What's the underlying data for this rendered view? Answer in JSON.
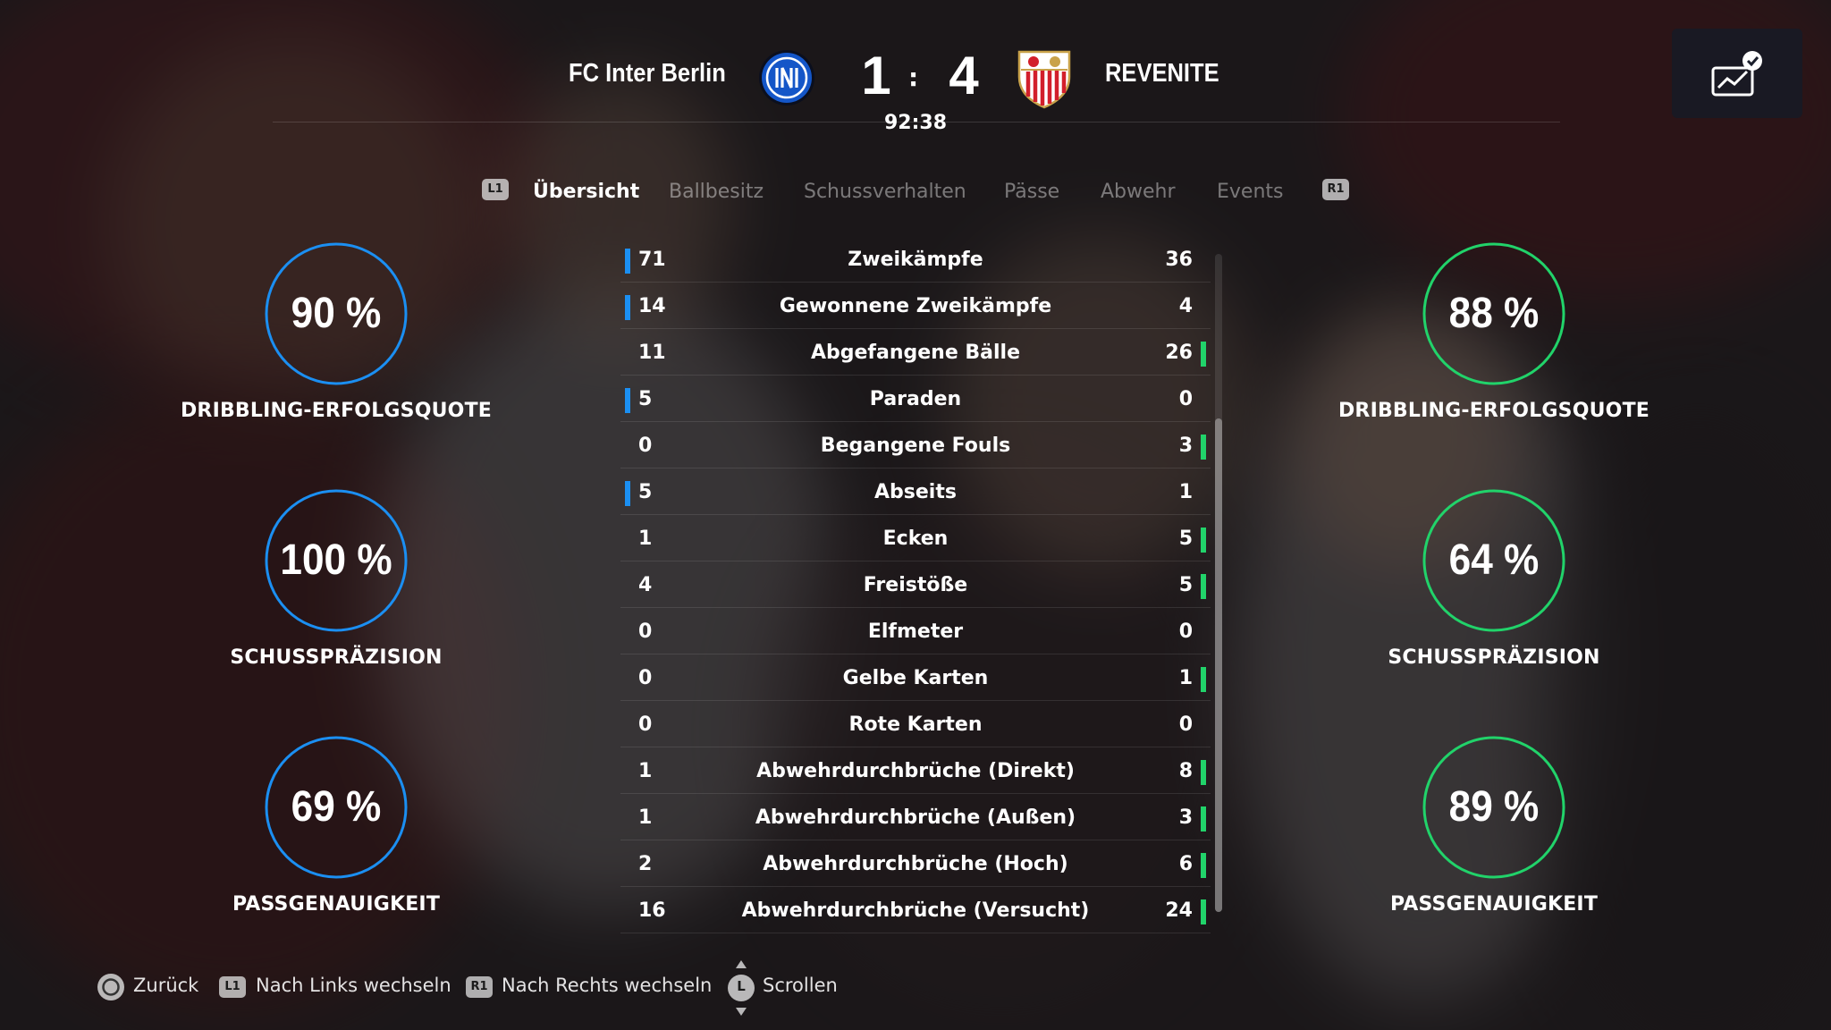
{
  "header": {
    "home_team": "FC Inter Berlin",
    "away_team": "REVENITE",
    "home_score": "1",
    "away_score": "4",
    "score_separator": ":",
    "clock": "92:38"
  },
  "tabs": {
    "left_button": "L1",
    "right_button": "R1",
    "items": [
      {
        "label": "Übersicht",
        "active": true
      },
      {
        "label": "Ballbesitz",
        "active": false
      },
      {
        "label": "Schussverhalten",
        "active": false
      },
      {
        "label": "Pässe",
        "active": false
      },
      {
        "label": "Abwehr",
        "active": false
      },
      {
        "label": "Events",
        "active": false
      }
    ]
  },
  "home_rings": [
    {
      "value": "90 %",
      "label": "DRIBBLING-ERFOLGSQUOTE"
    },
    {
      "value": "100 %",
      "label": "SCHUSSPRÄZISION"
    },
    {
      "value": "69 %",
      "label": "PASSGENAUIGKEIT"
    }
  ],
  "away_rings": [
    {
      "value": "88 %",
      "label": "DRIBBLING-ERFOLGSQUOTE"
    },
    {
      "value": "64 %",
      "label": "SCHUSSPRÄZISION"
    },
    {
      "value": "89 %",
      "label": "PASSGENAUIGKEIT"
    }
  ],
  "stats": [
    {
      "home": "71",
      "label": "Zweikämpfe",
      "away": "36",
      "leader": "home"
    },
    {
      "home": "14",
      "label": "Gewonnene Zweikämpfe",
      "away": "4",
      "leader": "home"
    },
    {
      "home": "11",
      "label": "Abgefangene Bälle",
      "away": "26",
      "leader": "away"
    },
    {
      "home": "5",
      "label": "Paraden",
      "away": "0",
      "leader": "home"
    },
    {
      "home": "0",
      "label": "Begangene Fouls",
      "away": "3",
      "leader": "away"
    },
    {
      "home": "5",
      "label": "Abseits",
      "away": "1",
      "leader": "home"
    },
    {
      "home": "1",
      "label": "Ecken",
      "away": "5",
      "leader": "away"
    },
    {
      "home": "4",
      "label": "Freistöße",
      "away": "5",
      "leader": "away"
    },
    {
      "home": "0",
      "label": "Elfmeter",
      "away": "0",
      "leader": "none"
    },
    {
      "home": "0",
      "label": "Gelbe Karten",
      "away": "1",
      "leader": "away"
    },
    {
      "home": "0",
      "label": "Rote Karten",
      "away": "0",
      "leader": "none"
    },
    {
      "home": "1",
      "label": "Abwehrdurchbrüche (Direkt)",
      "away": "8",
      "leader": "away"
    },
    {
      "home": "1",
      "label": "Abwehrdurchbrüche (Außen)",
      "away": "3",
      "leader": "away"
    },
    {
      "home": "2",
      "label": "Abwehrdurchbrüche (Hoch)",
      "away": "6",
      "leader": "away"
    },
    {
      "home": "16",
      "label": "Abwehrdurchbrüche (Versucht)",
      "away": "24",
      "leader": "away"
    }
  ],
  "footer": {
    "back_label": "Zurück",
    "l1_chip": "L1",
    "left_label": "Nach Links wechseln",
    "r1_chip": "R1",
    "right_label": "Nach Rechts wechseln",
    "stick_chip": "L",
    "scroll_label": "Scrollen"
  },
  "colors": {
    "home_accent": "#1b8ff2",
    "away_accent": "#21d36a"
  }
}
